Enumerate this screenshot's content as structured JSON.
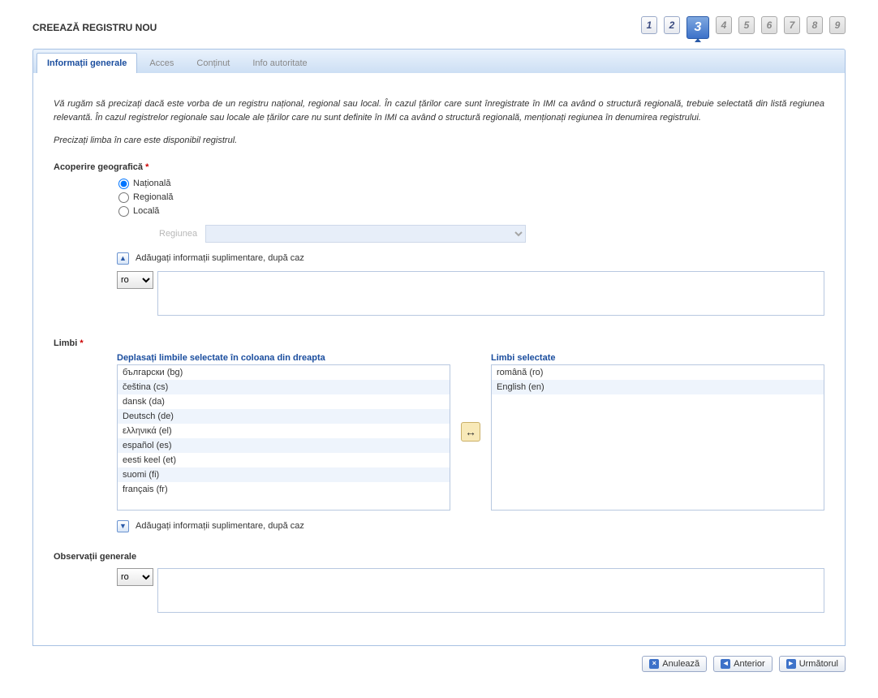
{
  "header": {
    "title": "CREEAZĂ REGISTRU NOU"
  },
  "steps": [
    {
      "n": "1",
      "state": "enabled"
    },
    {
      "n": "2",
      "state": "enabled"
    },
    {
      "n": "3",
      "state": "active"
    },
    {
      "n": "4",
      "state": "disabled"
    },
    {
      "n": "5",
      "state": "disabled"
    },
    {
      "n": "6",
      "state": "disabled"
    },
    {
      "n": "7",
      "state": "disabled"
    },
    {
      "n": "8",
      "state": "disabled"
    },
    {
      "n": "9",
      "state": "disabled"
    }
  ],
  "tabs": [
    {
      "label": "Informații generale",
      "active": true
    },
    {
      "label": "Acces",
      "active": false
    },
    {
      "label": "Conținut",
      "active": false
    },
    {
      "label": "Info autoritate",
      "active": false
    }
  ],
  "intro1": "Vă rugăm să precizați dacă este vorba de un registru național, regional sau local. În cazul țărilor care sunt înregistrate în IMI ca având o structură regională, trebuie selectată din listă regiunea relevantă. În cazul registrelor regionale sau locale ale țărilor care nu sunt definite în IMI ca având o structură regională, menționați regiunea în denumirea registrului.",
  "intro2": "Precizați limba în care este disponibil registrul.",
  "coverage": {
    "label": "Acoperire geografică",
    "options": {
      "national": "Națională",
      "regional": "Regională",
      "local": "Locală"
    },
    "selected": "national",
    "region_label": "Regiunea"
  },
  "additional_info_toggle": "Adăugați informații suplimentare, după caz",
  "lang_sel_value": "ro",
  "languages_section": {
    "label": "Limbi",
    "available_title": "Deplasați limbile selectate în coloana din dreapta",
    "selected_title": "Limbi selectate",
    "available": [
      "български (bg)",
      "čeština (cs)",
      "dansk (da)",
      "Deutsch (de)",
      "ελληνικά (el)",
      "español (es)",
      "eesti keel (et)",
      "suomi (fi)",
      "français (fr)"
    ],
    "selected": [
      "română (ro)",
      "English (en)"
    ]
  },
  "observations_label": "Observații generale",
  "footer": {
    "cancel": "Anulează",
    "prev": "Anterior",
    "next": "Următorul"
  }
}
